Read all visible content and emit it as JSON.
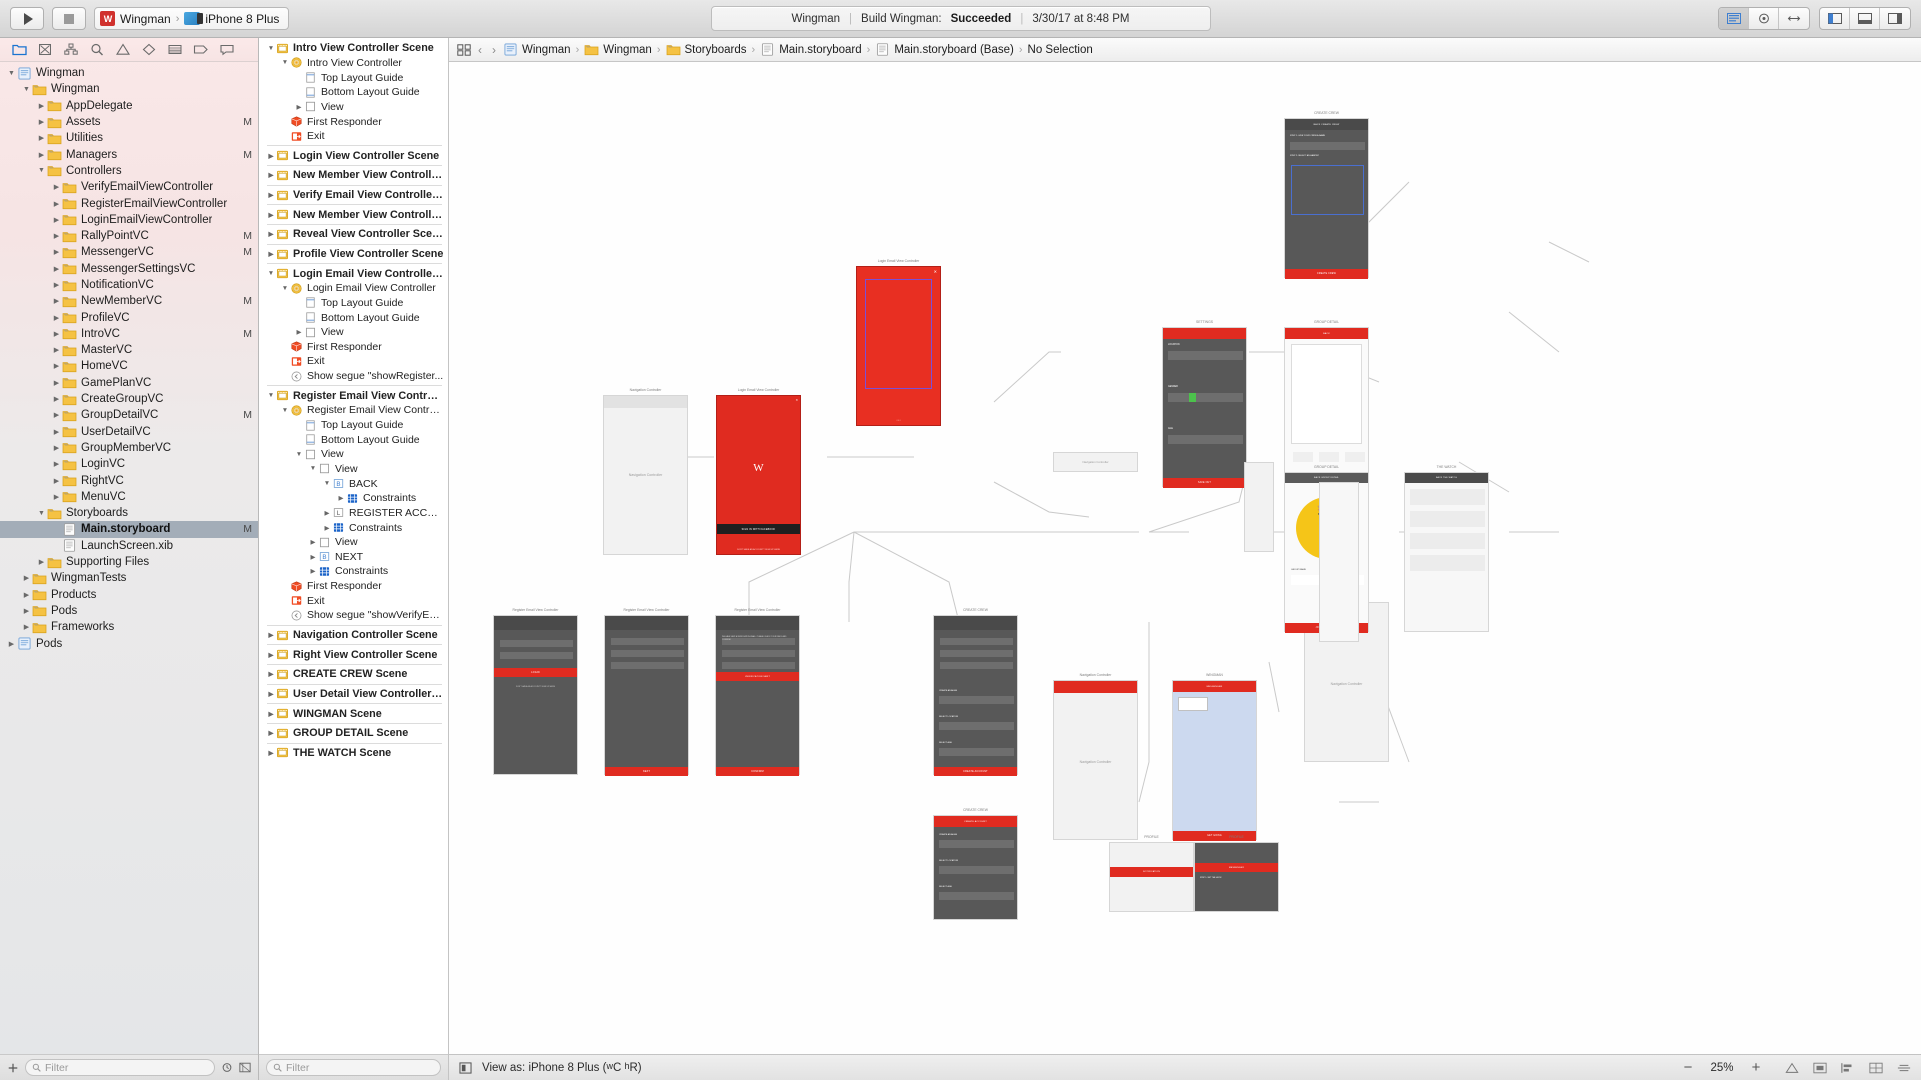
{
  "toolbar": {
    "run_button": "run-button",
    "stop_button": "stop-button",
    "scheme_badge": "W",
    "scheme_name": "Wingman",
    "destination": "iPhone 8 Plus",
    "status": {
      "project": "Wingman",
      "action": "Build Wingman:",
      "result": "Succeeded",
      "timestamp": "3/30/17 at 8:48 PM"
    }
  },
  "navigator": {
    "tabs": [
      "folder-icon",
      "warning-triangle-icon",
      "hierarchy-icon",
      "search-icon",
      "issue-icon",
      "test-icon",
      "debug-icon",
      "breakpoint-icon",
      "report-icon"
    ],
    "filter_placeholder": "Filter",
    "tree": [
      {
        "depth": 0,
        "label": "Wingman",
        "icon": "project-icon",
        "twist": "open",
        "mod": ""
      },
      {
        "depth": 1,
        "label": "Wingman",
        "icon": "folder-icon",
        "twist": "open",
        "mod": ""
      },
      {
        "depth": 2,
        "label": "AppDelegate",
        "icon": "folder-icon",
        "twist": "closed",
        "mod": ""
      },
      {
        "depth": 2,
        "label": "Assets",
        "icon": "folder-icon",
        "twist": "closed",
        "mod": "M"
      },
      {
        "depth": 2,
        "label": "Utilities",
        "icon": "folder-icon",
        "twist": "closed",
        "mod": ""
      },
      {
        "depth": 2,
        "label": "Managers",
        "icon": "folder-icon",
        "twist": "closed",
        "mod": "M"
      },
      {
        "depth": 2,
        "label": "Controllers",
        "icon": "folder-icon",
        "twist": "open",
        "mod": ""
      },
      {
        "depth": 3,
        "label": "VerifyEmailViewController",
        "icon": "folder-icon",
        "twist": "closed",
        "mod": ""
      },
      {
        "depth": 3,
        "label": "RegisterEmailViewController",
        "icon": "folder-icon",
        "twist": "closed",
        "mod": ""
      },
      {
        "depth": 3,
        "label": "LoginEmailViewController",
        "icon": "folder-icon",
        "twist": "closed",
        "mod": ""
      },
      {
        "depth": 3,
        "label": "RallyPointVC",
        "icon": "folder-icon",
        "twist": "closed",
        "mod": "M"
      },
      {
        "depth": 3,
        "label": "MessengerVC",
        "icon": "folder-icon",
        "twist": "closed",
        "mod": "M"
      },
      {
        "depth": 3,
        "label": "MessengerSettingsVC",
        "icon": "folder-icon",
        "twist": "closed",
        "mod": ""
      },
      {
        "depth": 3,
        "label": "NotificationVC",
        "icon": "folder-icon",
        "twist": "closed",
        "mod": ""
      },
      {
        "depth": 3,
        "label": "NewMemberVC",
        "icon": "folder-icon",
        "twist": "closed",
        "mod": "M"
      },
      {
        "depth": 3,
        "label": "ProfileVC",
        "icon": "folder-icon",
        "twist": "closed",
        "mod": ""
      },
      {
        "depth": 3,
        "label": "IntroVC",
        "icon": "folder-icon",
        "twist": "closed",
        "mod": "M"
      },
      {
        "depth": 3,
        "label": "MasterVC",
        "icon": "folder-icon",
        "twist": "closed",
        "mod": ""
      },
      {
        "depth": 3,
        "label": "HomeVC",
        "icon": "folder-icon",
        "twist": "closed",
        "mod": ""
      },
      {
        "depth": 3,
        "label": "GamePlanVC",
        "icon": "folder-icon",
        "twist": "closed",
        "mod": ""
      },
      {
        "depth": 3,
        "label": "CreateGroupVC",
        "icon": "folder-icon",
        "twist": "closed",
        "mod": ""
      },
      {
        "depth": 3,
        "label": "GroupDetailVC",
        "icon": "folder-icon",
        "twist": "closed",
        "mod": "M"
      },
      {
        "depth": 3,
        "label": "UserDetailVC",
        "icon": "folder-icon",
        "twist": "closed",
        "mod": ""
      },
      {
        "depth": 3,
        "label": "GroupMemberVC",
        "icon": "folder-icon",
        "twist": "closed",
        "mod": ""
      },
      {
        "depth": 3,
        "label": "LoginVC",
        "icon": "folder-icon",
        "twist": "closed",
        "mod": ""
      },
      {
        "depth": 3,
        "label": "RightVC",
        "icon": "folder-icon",
        "twist": "closed",
        "mod": ""
      },
      {
        "depth": 3,
        "label": "MenuVC",
        "icon": "folder-icon",
        "twist": "closed",
        "mod": ""
      },
      {
        "depth": 2,
        "label": "Storyboards",
        "icon": "folder-icon",
        "twist": "open",
        "mod": ""
      },
      {
        "depth": 3,
        "label": "Main.storyboard",
        "icon": "storyboard-icon",
        "twist": "none",
        "mod": "M",
        "selected": true
      },
      {
        "depth": 3,
        "label": "LaunchScreen.xib",
        "icon": "storyboard-icon",
        "twist": "none",
        "mod": ""
      },
      {
        "depth": 2,
        "label": "Supporting Files",
        "icon": "folder-icon",
        "twist": "closed",
        "mod": ""
      },
      {
        "depth": 1,
        "label": "WingmanTests",
        "icon": "folder-icon",
        "twist": "closed",
        "mod": ""
      },
      {
        "depth": 1,
        "label": "Products",
        "icon": "folder-icon",
        "twist": "closed",
        "mod": ""
      },
      {
        "depth": 1,
        "label": "Pods",
        "icon": "folder-icon",
        "twist": "closed",
        "mod": ""
      },
      {
        "depth": 1,
        "label": "Frameworks",
        "icon": "folder-icon",
        "twist": "closed",
        "mod": ""
      },
      {
        "depth": 0,
        "label": "Pods",
        "icon": "project-icon",
        "twist": "closed",
        "mod": ""
      }
    ]
  },
  "outline": {
    "filter_placeholder": "Filter",
    "rows": [
      {
        "depth": 0,
        "label": "Intro View Controller Scene",
        "icon": "scene-icon",
        "twist": "open",
        "scene": true
      },
      {
        "depth": 1,
        "label": "Intro View Controller",
        "icon": "vc-icon",
        "twist": "open"
      },
      {
        "depth": 2,
        "label": "Top Layout Guide",
        "icon": "top-guide-icon",
        "twist": "none"
      },
      {
        "depth": 2,
        "label": "Bottom Layout Guide",
        "icon": "bottom-guide-icon",
        "twist": "none"
      },
      {
        "depth": 2,
        "label": "View",
        "icon": "view-icon",
        "twist": "closed"
      },
      {
        "depth": 1,
        "label": "First Responder",
        "icon": "first-responder-icon",
        "twist": "none"
      },
      {
        "depth": 1,
        "label": "Exit",
        "icon": "exit-icon",
        "twist": "none"
      },
      {
        "sep": true
      },
      {
        "depth": 0,
        "label": "Login View Controller Scene",
        "icon": "scene-icon",
        "twist": "closed",
        "scene": true
      },
      {
        "sep": true
      },
      {
        "depth": 0,
        "label": "New Member View Controller...",
        "icon": "scene-icon",
        "twist": "closed",
        "scene": true
      },
      {
        "sep": true
      },
      {
        "depth": 0,
        "label": "Verify Email View Controller...",
        "icon": "scene-icon",
        "twist": "closed",
        "scene": true
      },
      {
        "sep": true
      },
      {
        "depth": 0,
        "label": "New Member View Controller...",
        "icon": "scene-icon",
        "twist": "closed",
        "scene": true
      },
      {
        "sep": true
      },
      {
        "depth": 0,
        "label": "Reveal View Controller Scene",
        "icon": "scene-icon",
        "twist": "closed",
        "scene": true
      },
      {
        "sep": true
      },
      {
        "depth": 0,
        "label": "Profile View Controller Scene",
        "icon": "scene-icon",
        "twist": "closed",
        "scene": true
      },
      {
        "sep": true
      },
      {
        "depth": 0,
        "label": "Login Email View Controller S...",
        "icon": "scene-icon",
        "twist": "open",
        "scene": true
      },
      {
        "depth": 1,
        "label": "Login Email View Controller",
        "icon": "vc-icon",
        "twist": "open"
      },
      {
        "depth": 2,
        "label": "Top Layout Guide",
        "icon": "top-guide-icon",
        "twist": "none"
      },
      {
        "depth": 2,
        "label": "Bottom Layout Guide",
        "icon": "bottom-guide-icon",
        "twist": "none"
      },
      {
        "depth": 2,
        "label": "View",
        "icon": "view-icon",
        "twist": "closed"
      },
      {
        "depth": 1,
        "label": "First Responder",
        "icon": "first-responder-icon",
        "twist": "none"
      },
      {
        "depth": 1,
        "label": "Exit",
        "icon": "exit-icon",
        "twist": "none"
      },
      {
        "depth": 1,
        "label": "Show segue \"showRegister...",
        "icon": "segue-icon",
        "twist": "none"
      },
      {
        "sep": true
      },
      {
        "depth": 0,
        "label": "Register Email View Controlle...",
        "icon": "scene-icon",
        "twist": "open",
        "scene": true
      },
      {
        "depth": 1,
        "label": "Register Email View Control...",
        "icon": "vc-icon",
        "twist": "open"
      },
      {
        "depth": 2,
        "label": "Top Layout Guide",
        "icon": "top-guide-icon",
        "twist": "none"
      },
      {
        "depth": 2,
        "label": "Bottom Layout Guide",
        "icon": "bottom-guide-icon",
        "twist": "none"
      },
      {
        "depth": 2,
        "label": "View",
        "icon": "view-icon",
        "twist": "open"
      },
      {
        "depth": 3,
        "label": "View",
        "icon": "view-icon",
        "twist": "open"
      },
      {
        "depth": 4,
        "label": "BACK",
        "icon": "button-icon",
        "twist": "open"
      },
      {
        "depth": 5,
        "label": "Constraints",
        "icon": "constraints-icon",
        "twist": "closed"
      },
      {
        "depth": 4,
        "label": "REGISTER ACCO...",
        "icon": "label-icon",
        "twist": "closed"
      },
      {
        "depth": 4,
        "label": "Constraints",
        "icon": "constraints-icon",
        "twist": "closed"
      },
      {
        "depth": 3,
        "label": "View",
        "icon": "view-icon",
        "twist": "closed"
      },
      {
        "depth": 3,
        "label": "NEXT",
        "icon": "button-icon",
        "twist": "closed"
      },
      {
        "depth": 3,
        "label": "Constraints",
        "icon": "constraints-icon",
        "twist": "closed"
      },
      {
        "depth": 1,
        "label": "First Responder",
        "icon": "first-responder-icon",
        "twist": "none"
      },
      {
        "depth": 1,
        "label": "Exit",
        "icon": "exit-icon",
        "twist": "none"
      },
      {
        "depth": 1,
        "label": "Show segue \"showVerifyEm...",
        "icon": "segue-icon",
        "twist": "none"
      },
      {
        "sep": true
      },
      {
        "depth": 0,
        "label": "Navigation Controller Scene",
        "icon": "scene-icon",
        "twist": "closed",
        "scene": true
      },
      {
        "sep": true
      },
      {
        "depth": 0,
        "label": "Right View Controller Scene",
        "icon": "scene-icon",
        "twist": "closed",
        "scene": true
      },
      {
        "sep": true
      },
      {
        "depth": 0,
        "label": "CREATE CREW Scene",
        "icon": "scene-icon",
        "twist": "closed",
        "scene": true
      },
      {
        "sep": true
      },
      {
        "depth": 0,
        "label": "User Detail View Controller S...",
        "icon": "scene-icon",
        "twist": "closed",
        "scene": true
      },
      {
        "sep": true
      },
      {
        "depth": 0,
        "label": "WINGMAN Scene",
        "icon": "scene-icon",
        "twist": "closed",
        "scene": true
      },
      {
        "sep": true
      },
      {
        "depth": 0,
        "label": "GROUP DETAIL Scene",
        "icon": "scene-icon",
        "twist": "closed",
        "scene": true
      },
      {
        "sep": true
      },
      {
        "depth": 0,
        "label": "THE WATCH Scene",
        "icon": "scene-icon",
        "twist": "closed",
        "scene": true
      }
    ]
  },
  "jump_bar": {
    "back": "‹",
    "forward": "›",
    "crumbs": [
      {
        "label": "Wingman",
        "icon": "project-icon"
      },
      {
        "label": "Wingman",
        "icon": "folder-icon"
      },
      {
        "label": "Storyboards",
        "icon": "folder-icon"
      },
      {
        "label": "Main.storyboard",
        "icon": "storyboard-icon"
      },
      {
        "label": "Main.storyboard (Base)",
        "icon": "storyboard-icon"
      },
      {
        "label": "No Selection",
        "icon": "none"
      }
    ]
  },
  "editor_bottom": {
    "view_as_prefix": "View as: iPhone 8 Plus (",
    "view_as_traits_w": "w",
    "view_as_traits_wc": "C ",
    "view_as_traits_h": "h",
    "view_as_traits_hr": "R)",
    "zoom_out": "−",
    "zoom_value": "25%",
    "zoom_in": "+"
  },
  "canvas": {
    "scene_labels": {
      "navigation_controller": "Navigation Controller",
      "login_email": "Login Email View Controller",
      "register_email": "Register Email View Controller",
      "intro": "Intro View Controller",
      "create_crew": "CREATE CREW",
      "settings": "SETTINGS",
      "group_detail": "GROUP DETAIL",
      "the_watch": "THE WATCH",
      "wingman": "WINGMAN",
      "profile": "PROFILE"
    },
    "phone_texts": {
      "sign_in_facebook": "SIGN IN WITH FACEBOOK",
      "dont_have_account": "DON'T HAVE AN ACCOUNT? SIGN UP HERE",
      "back": "BACK",
      "next": "NEXT",
      "confirm": "CONFIRM",
      "login": "LOGIN",
      "create_crew": "CREATE CREW",
      "create_account": "CREATE ACCOUNT",
      "join_watch": "JOIN THE WATCH",
      "save_out": "SAVE OUT",
      "wingman_w": "W",
      "group_name": "GROUP NAME",
      "create_an_alias": "CREATE AN ALIAS",
      "select_location": "SELECT LOCATION",
      "select_age": "SELECT AGE",
      "location": "LOCATION",
      "gender": "GENDER",
      "age": "AGE",
      "step1": "STEP 1: GIVE YOUR CREW A NAME",
      "step2": "STEP 2: SELECT AN HABITAT",
      "get_going": "GET GOING",
      "new_message": "NEW MESSAGE"
    },
    "close_badge": "✕"
  }
}
